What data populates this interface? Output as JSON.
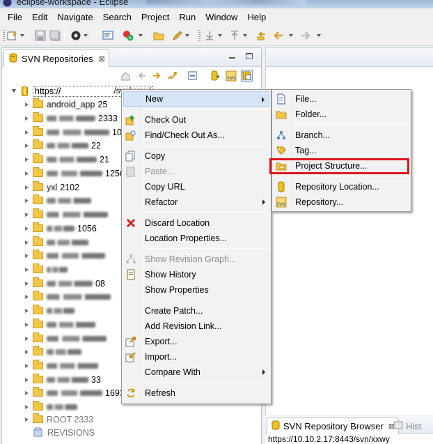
{
  "window": {
    "title": "eclipse-workspace - Eclipse"
  },
  "menubar": {
    "items": [
      "File",
      "Edit",
      "Navigate",
      "Search",
      "Project",
      "Run",
      "Window",
      "Help"
    ]
  },
  "svn_view": {
    "tab_label": "SVN Repositories",
    "close_glyph": "⊠",
    "tree": {
      "root_url": "https://",
      "root_url_tail": "/svn/xxwy/",
      "rows": [
        {
          "text": "android_app",
          "tail": "25"
        },
        {
          "text": "",
          "tail": "2333"
        },
        {
          "text": "",
          "tail": "1026"
        },
        {
          "text": "",
          "tail": "22"
        },
        {
          "text": "",
          "tail": "21"
        },
        {
          "text": "",
          "tail": "1256"
        },
        {
          "text": "yxl",
          "tail": "2102"
        },
        {
          "text": "",
          "tail": ""
        },
        {
          "text": "",
          "tail": ""
        },
        {
          "text": "",
          "tail": "1056"
        },
        {
          "text": "",
          "tail": ""
        },
        {
          "text": "",
          "tail": ""
        },
        {
          "text": "",
          "tail": ""
        },
        {
          "text": "",
          "tail": "08"
        },
        {
          "text": "",
          "tail": ""
        },
        {
          "text": "",
          "tail": ""
        },
        {
          "text": "",
          "tail": ""
        },
        {
          "text": "",
          "tail": ""
        },
        {
          "text": "",
          "tail": ""
        },
        {
          "text": "",
          "tail": ""
        },
        {
          "text": "",
          "tail": "33"
        },
        {
          "text": "",
          "tail": "1693"
        },
        {
          "text": "",
          "tail": ""
        }
      ],
      "root_2333": "ROOT 2333",
      "revisions": "REVISIONS"
    }
  },
  "context_menu": {
    "items": [
      {
        "label": "New",
        "submenu": true,
        "icon": "none"
      },
      {
        "sep": true
      },
      {
        "label": "Check Out",
        "icon": "checkout-icon"
      },
      {
        "label": "Find/Check Out As...",
        "icon": "find-checkout-icon"
      },
      {
        "sep": true
      },
      {
        "label": "Copy",
        "icon": "copy-icon"
      },
      {
        "label": "Paste...",
        "icon": "paste-icon",
        "disabled": true
      },
      {
        "label": "Copy URL",
        "icon": "none"
      },
      {
        "label": "Refactor",
        "submenu": true,
        "icon": "none"
      },
      {
        "sep": true
      },
      {
        "label": "Discard Location",
        "icon": "discard-icon"
      },
      {
        "label": "Location Properties...",
        "icon": "none"
      },
      {
        "sep": true
      },
      {
        "label": "Show Revision Graph...",
        "icon": "revision-graph-icon",
        "disabled": true
      },
      {
        "label": "Show History",
        "icon": "history-icon"
      },
      {
        "label": "Show Properties",
        "icon": "none"
      },
      {
        "sep": true
      },
      {
        "label": "Create Patch...",
        "icon": "none"
      },
      {
        "label": "Add Revision Link...",
        "icon": "none"
      },
      {
        "label": "Export...",
        "icon": "export-icon"
      },
      {
        "label": "Import...",
        "icon": "import-icon"
      },
      {
        "label": "Compare With",
        "submenu": true,
        "icon": "none"
      },
      {
        "sep": true
      },
      {
        "label": "Refresh",
        "icon": "refresh-icon"
      }
    ]
  },
  "new_submenu": {
    "items": [
      {
        "label": "File...",
        "icon": "file-icon"
      },
      {
        "label": "Folder...",
        "icon": "folder-icon"
      },
      {
        "sep": true
      },
      {
        "label": "Branch...",
        "icon": "branch-icon"
      },
      {
        "label": "Tag...",
        "icon": "tag-icon"
      },
      {
        "label": "Project Structure...",
        "icon": "project-structure-icon",
        "highlighted": true
      },
      {
        "sep": true
      },
      {
        "label": "Repository Location...",
        "icon": "repository-location-icon"
      },
      {
        "label": "Repository...",
        "icon": "repository-icon"
      }
    ]
  },
  "bottom_panel": {
    "tabs": [
      "SVN Repository Browser",
      "Hist"
    ],
    "close_glyph": "⊠",
    "url": "https://10.10.2.17:8443/svn/xxwy"
  },
  "colors": {
    "highlight_box": "#e0141e",
    "menu_bg": "#f2f2f2",
    "selection": "#d6e5f5"
  }
}
